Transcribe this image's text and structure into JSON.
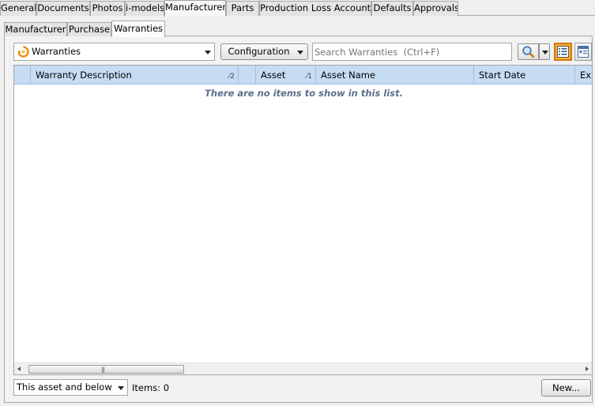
{
  "top_tabs": [
    {
      "label": "General"
    },
    {
      "label": "Documents"
    },
    {
      "label": "Photos"
    },
    {
      "label": "i-models"
    },
    {
      "label": "Manufacturer"
    },
    {
      "label": "Parts"
    },
    {
      "label": "Production Loss Accounting"
    },
    {
      "label": "Defaults"
    },
    {
      "label": "Approvals"
    }
  ],
  "active_top_tab": "Manufacturer",
  "sub_tabs": [
    {
      "label": "Manufacturer"
    },
    {
      "label": "Purchase"
    },
    {
      "label": "Warranties"
    }
  ],
  "active_sub_tab": "Warranties",
  "toolbar": {
    "view_selector": "Warranties",
    "view_icon": "refresh-circle-icon",
    "configuration_label": "Configuration",
    "search_placeholder": "Search Warranties  (Ctrl+F)",
    "search_icon": "magnifier-icon",
    "list_view_icon": "list-view-icon",
    "detail_view_icon": "detail-view-icon"
  },
  "grid": {
    "columns": [
      {
        "label": "",
        "sort": ""
      },
      {
        "label": "Warranty Description",
        "sort": "2"
      },
      {
        "label": "",
        "sort": ""
      },
      {
        "label": "Asset",
        "sort": "1"
      },
      {
        "label": "Asset Name",
        "sort": ""
      },
      {
        "label": "Start Date",
        "sort": ""
      },
      {
        "label": "Exp",
        "sort": ""
      }
    ],
    "empty_message": "There are no items to show in this list."
  },
  "footer": {
    "scope_selector": "This asset and below",
    "items_count": "Items: 0",
    "new_button": "New..."
  },
  "colors": {
    "header_bg": "#c5dcf3",
    "active_view_btn": "#f7b23a",
    "empty_text": "#5b6f8c"
  }
}
